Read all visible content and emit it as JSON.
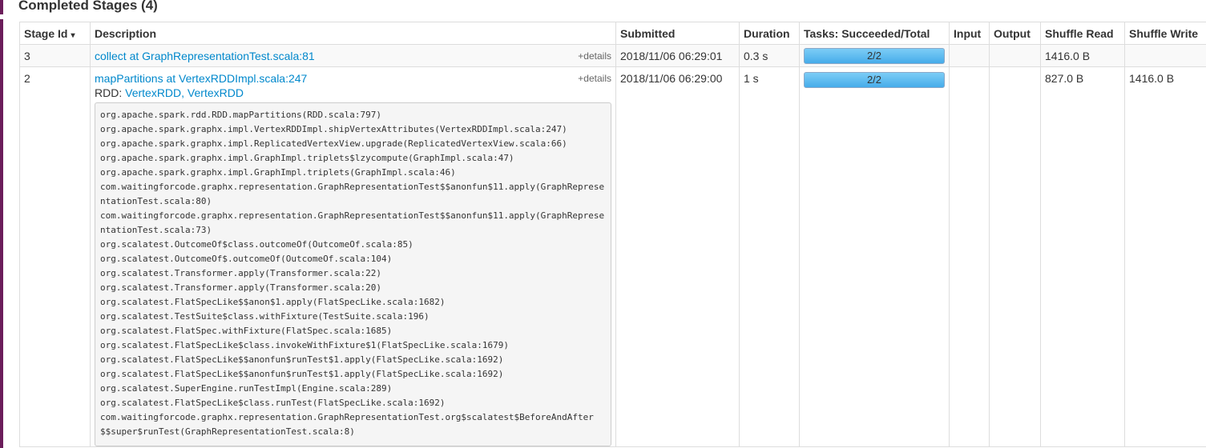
{
  "section": {
    "title": "Completed Stages (4)"
  },
  "table": {
    "headers": {
      "stage_id": "Stage Id",
      "sort_indicator": "▾",
      "description": "Description",
      "submitted": "Submitted",
      "duration": "Duration",
      "tasks": "Tasks: Succeeded/Total",
      "input": "Input",
      "output": "Output",
      "shuffle_read": "Shuffle Read",
      "shuffle_write": "Shuffle Write"
    },
    "rows": [
      {
        "stage_id": "3",
        "description": "collect at GraphRepresentationTest.scala:81",
        "details": "+details",
        "submitted": "2018/11/06 06:29:01",
        "duration": "0.3 s",
        "tasks": "2/2",
        "tasks_progress": 1.0,
        "input": "",
        "output": "",
        "shuffle_read": "1416.0 B",
        "shuffle_write": ""
      },
      {
        "stage_id": "2",
        "description": "mapPartitions at VertexRDDImpl.scala:247",
        "details": "+details",
        "rdd_label": "RDD: ",
        "rdd_links": "VertexRDD, VertexRDD",
        "stacktrace": "org.apache.spark.rdd.RDD.mapPartitions(RDD.scala:797)\norg.apache.spark.graphx.impl.VertexRDDImpl.shipVertexAttributes(VertexRDDImpl.scala:247)\norg.apache.spark.graphx.impl.ReplicatedVertexView.upgrade(ReplicatedVertexView.scala:66)\norg.apache.spark.graphx.impl.GraphImpl.triplets$lzycompute(GraphImpl.scala:47)\norg.apache.spark.graphx.impl.GraphImpl.triplets(GraphImpl.scala:46)\ncom.waitingforcode.graphx.representation.GraphRepresentationTest$$anonfun$11.apply(GraphRepresentationTest.scala:80)\ncom.waitingforcode.graphx.representation.GraphRepresentationTest$$anonfun$11.apply(GraphRepresentationTest.scala:73)\norg.scalatest.OutcomeOf$class.outcomeOf(OutcomeOf.scala:85)\norg.scalatest.OutcomeOf$.outcomeOf(OutcomeOf.scala:104)\norg.scalatest.Transformer.apply(Transformer.scala:22)\norg.scalatest.Transformer.apply(Transformer.scala:20)\norg.scalatest.FlatSpecLike$$anon$1.apply(FlatSpecLike.scala:1682)\norg.scalatest.TestSuite$class.withFixture(TestSuite.scala:196)\norg.scalatest.FlatSpec.withFixture(FlatSpec.scala:1685)\norg.scalatest.FlatSpecLike$class.invokeWithFixture$1(FlatSpecLike.scala:1679)\norg.scalatest.FlatSpecLike$$anonfun$runTest$1.apply(FlatSpecLike.scala:1692)\norg.scalatest.FlatSpecLike$$anonfun$runTest$1.apply(FlatSpecLike.scala:1692)\norg.scalatest.SuperEngine.runTestImpl(Engine.scala:289)\norg.scalatest.FlatSpecLike$class.runTest(FlatSpecLike.scala:1692)\ncom.waitingforcode.graphx.representation.GraphRepresentationTest.org$scalatest$BeforeAndAfter$$super$runTest(GraphRepresentationTest.scala:8)",
        "submitted": "2018/11/06 06:29:00",
        "duration": "1 s",
        "tasks": "2/2",
        "tasks_progress": 1.0,
        "input": "",
        "output": "",
        "shuffle_read": "827.0 B",
        "shuffle_write": "1416.0 B"
      }
    ]
  },
  "colors": {
    "link": "#0088cc",
    "progress_bar": "#5ab9ee",
    "sidebar_strip": "#6b1d5a"
  }
}
